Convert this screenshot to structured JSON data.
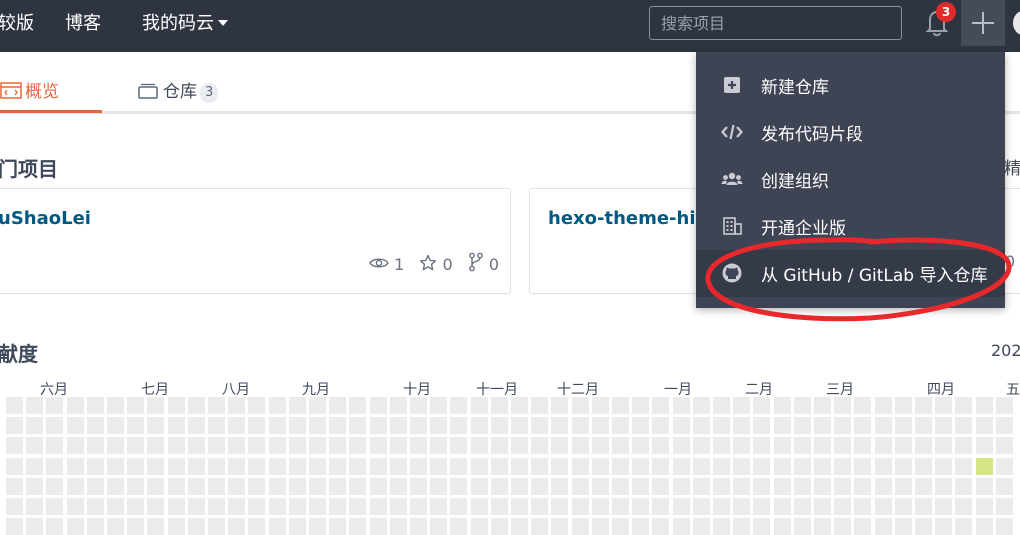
{
  "nav": {
    "items": [
      "较版",
      "博客",
      "我的码云"
    ],
    "search_placeholder": "搜索项目",
    "notification_count": "3"
  },
  "tabs": [
    {
      "label": "概览"
    },
    {
      "label": "仓库",
      "count": "3"
    }
  ],
  "projects": {
    "title": "门项目",
    "more_edge": "精",
    "cards": [
      {
        "name": "uShaoLei",
        "watchers": "1",
        "stars": "0",
        "forks": "0"
      },
      {
        "name": "hexo-theme-hiy"
      }
    ],
    "right_edge_fragment": "0"
  },
  "activity": {
    "title": "献度",
    "year_edge": "202",
    "months": [
      "六月",
      "七月",
      "八月",
      "九月",
      "十月",
      "十一月",
      "十二月",
      "一月",
      "二月",
      "三月",
      "四月",
      "五"
    ]
  },
  "dropdown": {
    "items": [
      {
        "label": "新建仓库",
        "icon": "plus-square-icon"
      },
      {
        "label": "发布代码片段",
        "icon": "code-icon"
      },
      {
        "label": "创建组织",
        "icon": "users-icon"
      },
      {
        "label": "开通企业版",
        "icon": "building-icon"
      },
      {
        "label": "从 GitHub / GitLab 导入仓库",
        "icon": "github-icon"
      }
    ]
  },
  "colors": {
    "topbar": "#2f3441",
    "accent": "#e8673d",
    "link": "#005980",
    "dropdown_bg": "#3e4454",
    "annotation": "#e8282b",
    "heat_active": "#d6e685"
  }
}
